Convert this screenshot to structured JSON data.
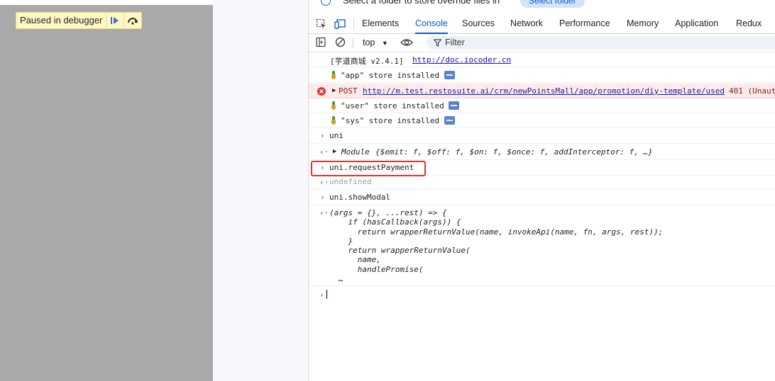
{
  "page": {
    "paused_label": "Paused in debugger"
  },
  "infobar": {
    "message": "Select a folder to store override files in",
    "button": "Select folder"
  },
  "tabs": [
    "Elements",
    "Console",
    "Sources",
    "Network",
    "Performance",
    "Memory",
    "Application",
    "Redux"
  ],
  "active_tab": "Console",
  "toolbar": {
    "context": "top",
    "filter_placeholder": "Filter"
  },
  "console": {
    "log_header_prefix": "[芋道商城 v2.4.1]",
    "log_header_link": "http://doc.iocoder.cn",
    "store_app": "\"app\" store installed",
    "error_method": "POST",
    "error_url": "http://m.test.restosuite.ai/crm/newPointsMall/app/promotion/diy-template/used",
    "error_status": "401 (Unaut",
    "store_user": "\"user\" store installed",
    "store_sys": "\"sys\" store installed",
    "input_uni": "uni",
    "module_label": "Module",
    "module_props": "{$emit: f, $off: f, $on: f, $once: f, addInterceptor: f, …}",
    "input_request_payment": "uni.requestPayment",
    "result_undefined": "undefined",
    "input_show_modal": "uni.showModal",
    "function_source": "(args = {}, ...rest) => {\n    if (hasCallback(args)) {\n      return wrapperReturnValue(name, invokeApi(name, fn, args, rest));\n    }\n    return wrapperReturnValue(\n      name,\n      handlePromise(\n  …"
  },
  "colors": {
    "accent": "#0b57d0",
    "error_bg": "#fcebeb",
    "highlight_box": "#e0342f",
    "paused_bg": "#fff8c4"
  }
}
